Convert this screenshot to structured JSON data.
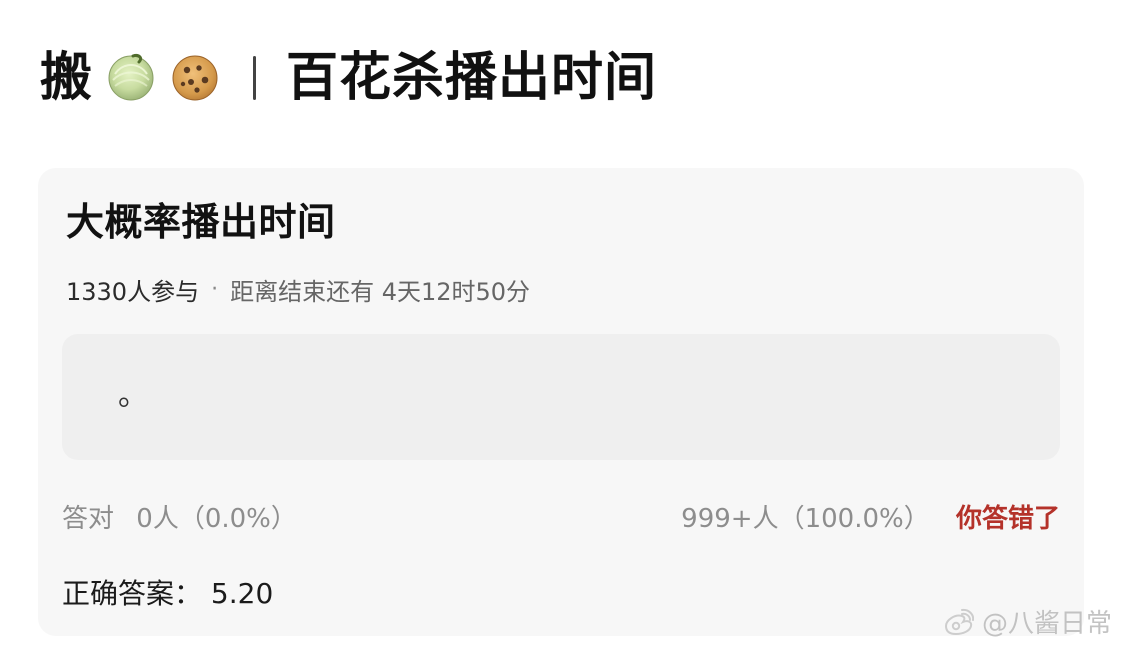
{
  "header": {
    "prefix": "搬",
    "divider": "|",
    "title": "百花杀播出时间",
    "icons": [
      "melon-icon",
      "cookie-icon"
    ]
  },
  "card": {
    "title": "大概率播出时间",
    "participants": "1330人参与",
    "separator": "·",
    "deadline": "距离结束还有 4天12时50分",
    "answer_text": "。",
    "correct_label": "答对",
    "correct_count": "0人（0.0%）",
    "wrong_count": "999+人（100.0%）",
    "wrong_text": "你答错了",
    "correct_answer_label": "正确答案：",
    "correct_answer_value": "5.20"
  },
  "watermark": {
    "text": "@八酱日常",
    "icon": "weibo-icon"
  },
  "colors": {
    "card_bg": "#f7f7f7",
    "answer_bg": "#efefef",
    "wrong_red": "#b4322a",
    "muted_gray": "#8d8d8d"
  }
}
